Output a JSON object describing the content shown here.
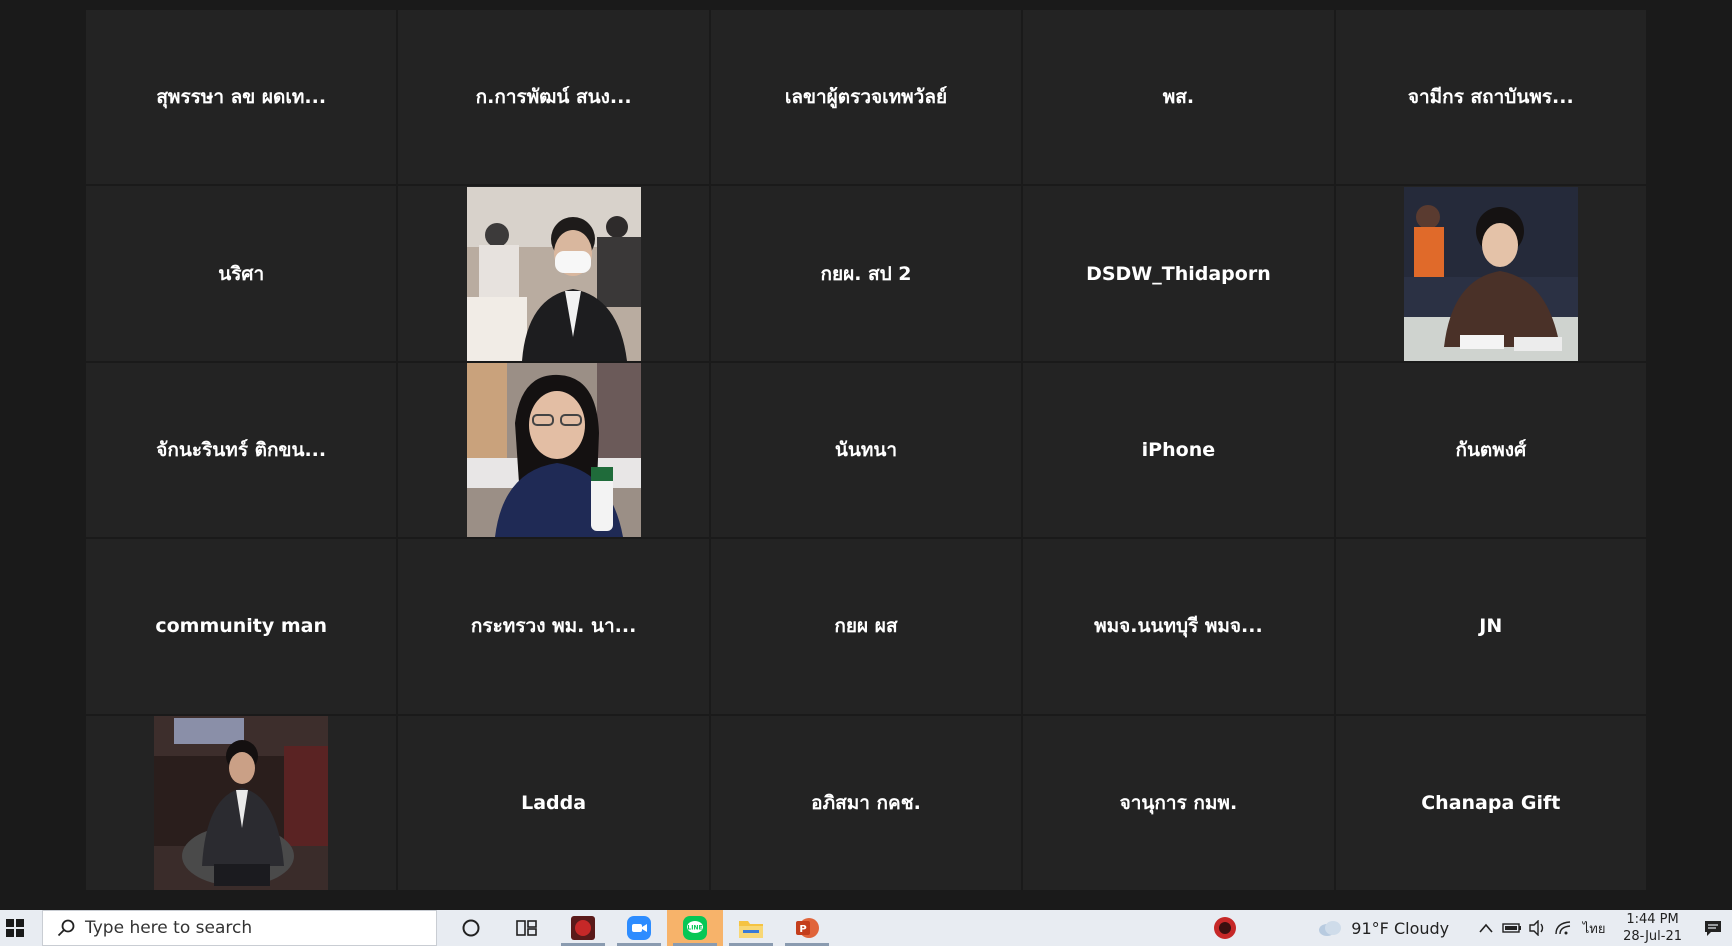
{
  "tiles": [
    {
      "name": "สุพรรษา ลข ผดเท...",
      "video": false
    },
    {
      "name": "ก.การพัฒน์ สนง...",
      "video": false
    },
    {
      "name": "เลขาผู้ตรวจเทพวัลย์",
      "video": false
    },
    {
      "name": "พส.",
      "video": false
    },
    {
      "name": "จามีกร สถาบันพร...",
      "video": false
    },
    {
      "name": "นริศา",
      "video": false
    },
    {
      "name": "",
      "video": true,
      "thumb": "man-mask-photo"
    },
    {
      "name": "กยผ. สป 2",
      "video": false
    },
    {
      "name": "DSDW_Thidaporn",
      "video": false
    },
    {
      "name": "",
      "video": true,
      "thumb": "woman-speaking-photo"
    },
    {
      "name": "จักนะรินทร์ ติกขน...",
      "video": false
    },
    {
      "name": "",
      "video": true,
      "thumb": "woman-glasses-photo"
    },
    {
      "name": "นันทนา",
      "video": false
    },
    {
      "name": "iPhone",
      "video": false
    },
    {
      "name": "กันตพงศ์",
      "video": false
    },
    {
      "name": "community man",
      "video": false
    },
    {
      "name": "กระทรวง พม. นา...",
      "video": false
    },
    {
      "name": "กยผ ผส",
      "video": false
    },
    {
      "name": "พมจ.นนทบุรี พมจ...",
      "video": false
    },
    {
      "name": "JN",
      "video": false
    },
    {
      "name": "",
      "video": true,
      "thumb": "man-seated-photo"
    },
    {
      "name": "Ladda",
      "video": false
    },
    {
      "name": "อภิสมา กคช.",
      "video": false
    },
    {
      "name": "จานุการ กมพ.",
      "video": false
    },
    {
      "name": "Chanapa Gift",
      "video": false
    }
  ],
  "taskbar": {
    "search_placeholder": "Type here to search",
    "weather": "91°F  Cloudy",
    "language": "ไทย",
    "time": "1:44 PM",
    "date": "28-Jul-21",
    "apps": [
      "cortana-icon",
      "task-view-icon",
      "app-red-icon",
      "zoom-icon",
      "line-icon",
      "file-explorer-icon",
      "powerpoint-icon"
    ]
  },
  "colors": {
    "background": "#1a1a1a",
    "tile": "#232323",
    "taskbar": "#e8ecf2"
  }
}
